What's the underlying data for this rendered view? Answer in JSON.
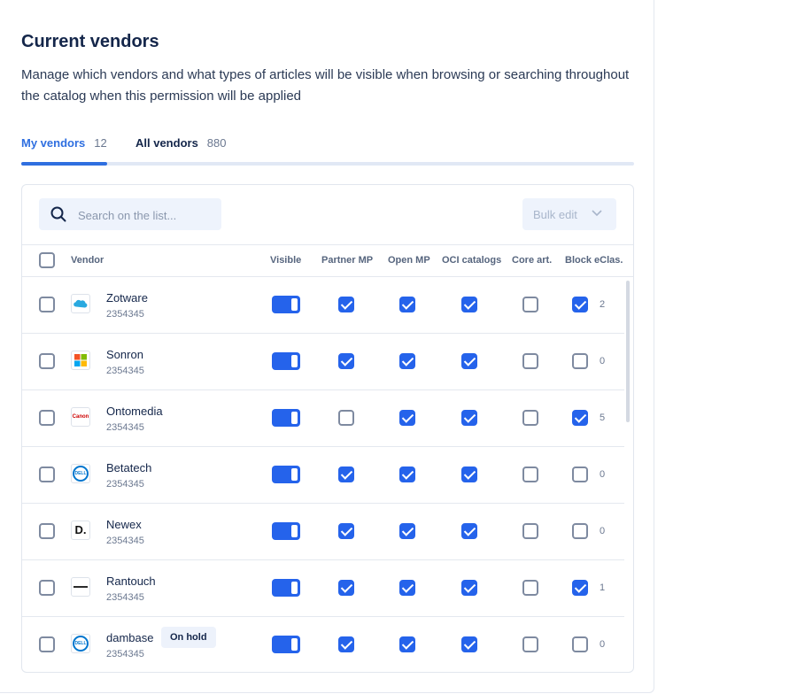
{
  "header": {
    "title": "Current vendors",
    "description": "Manage which vendors and what types of articles will be visible when browsing or searching throughout the catalog when this permission will be applied"
  },
  "tabs": [
    {
      "label": "My vendors",
      "count": "12",
      "active": true
    },
    {
      "label": "All vendors",
      "count": "880",
      "active": false
    }
  ],
  "toolbar": {
    "search_placeholder": "Search on the list...",
    "bulk_edit_label": "Bulk edit",
    "bulk_edit_disabled": true
  },
  "table": {
    "columns": [
      "Vendor",
      "Visible",
      "Partner MP",
      "Open MP",
      "OCI catalogs",
      "Core art.",
      "Block eClas."
    ],
    "rows": [
      {
        "name": "Zotware",
        "id": "2354345",
        "logo": "salesforce-cloud-logo",
        "visible": true,
        "partner_mp": true,
        "open_mp": true,
        "oci": true,
        "core": false,
        "block": true,
        "block_count": "2"
      },
      {
        "name": "Sonron",
        "id": "2354345",
        "logo": "microsoft-logo",
        "visible": true,
        "partner_mp": true,
        "open_mp": true,
        "oci": true,
        "core": false,
        "block": false,
        "block_count": "0"
      },
      {
        "name": "Ontomedia",
        "id": "2354345",
        "logo": "canon-logo",
        "logo_text": "Canon",
        "visible": true,
        "partner_mp": false,
        "open_mp": true,
        "oci": true,
        "core": false,
        "block": true,
        "block_count": "5"
      },
      {
        "name": "Betatech",
        "id": "2354345",
        "logo": "dell-logo",
        "logo_text": "DELL",
        "visible": true,
        "partner_mp": true,
        "open_mp": true,
        "oci": true,
        "core": false,
        "block": false,
        "block_count": "0"
      },
      {
        "name": "Newex",
        "id": "2354345",
        "logo": "d-logo",
        "logo_text": "D.",
        "visible": true,
        "partner_mp": true,
        "open_mp": true,
        "oci": true,
        "core": false,
        "block": false,
        "block_count": "0"
      },
      {
        "name": "Rantouch",
        "id": "2354345",
        "logo": "wordmark-logo",
        "visible": true,
        "partner_mp": true,
        "open_mp": true,
        "oci": true,
        "core": false,
        "block": true,
        "block_count": "1"
      },
      {
        "name": "dambase",
        "id": "2354345",
        "logo": "dell-logo",
        "logo_text": "DELL",
        "badge": "On hold",
        "visible": true,
        "partner_mp": true,
        "open_mp": true,
        "oci": true,
        "core": false,
        "block": false,
        "block_count": "0"
      }
    ]
  },
  "colors": {
    "accent": "#2563eb",
    "tab_active": "#2f6fe0",
    "title": "#14264a"
  }
}
